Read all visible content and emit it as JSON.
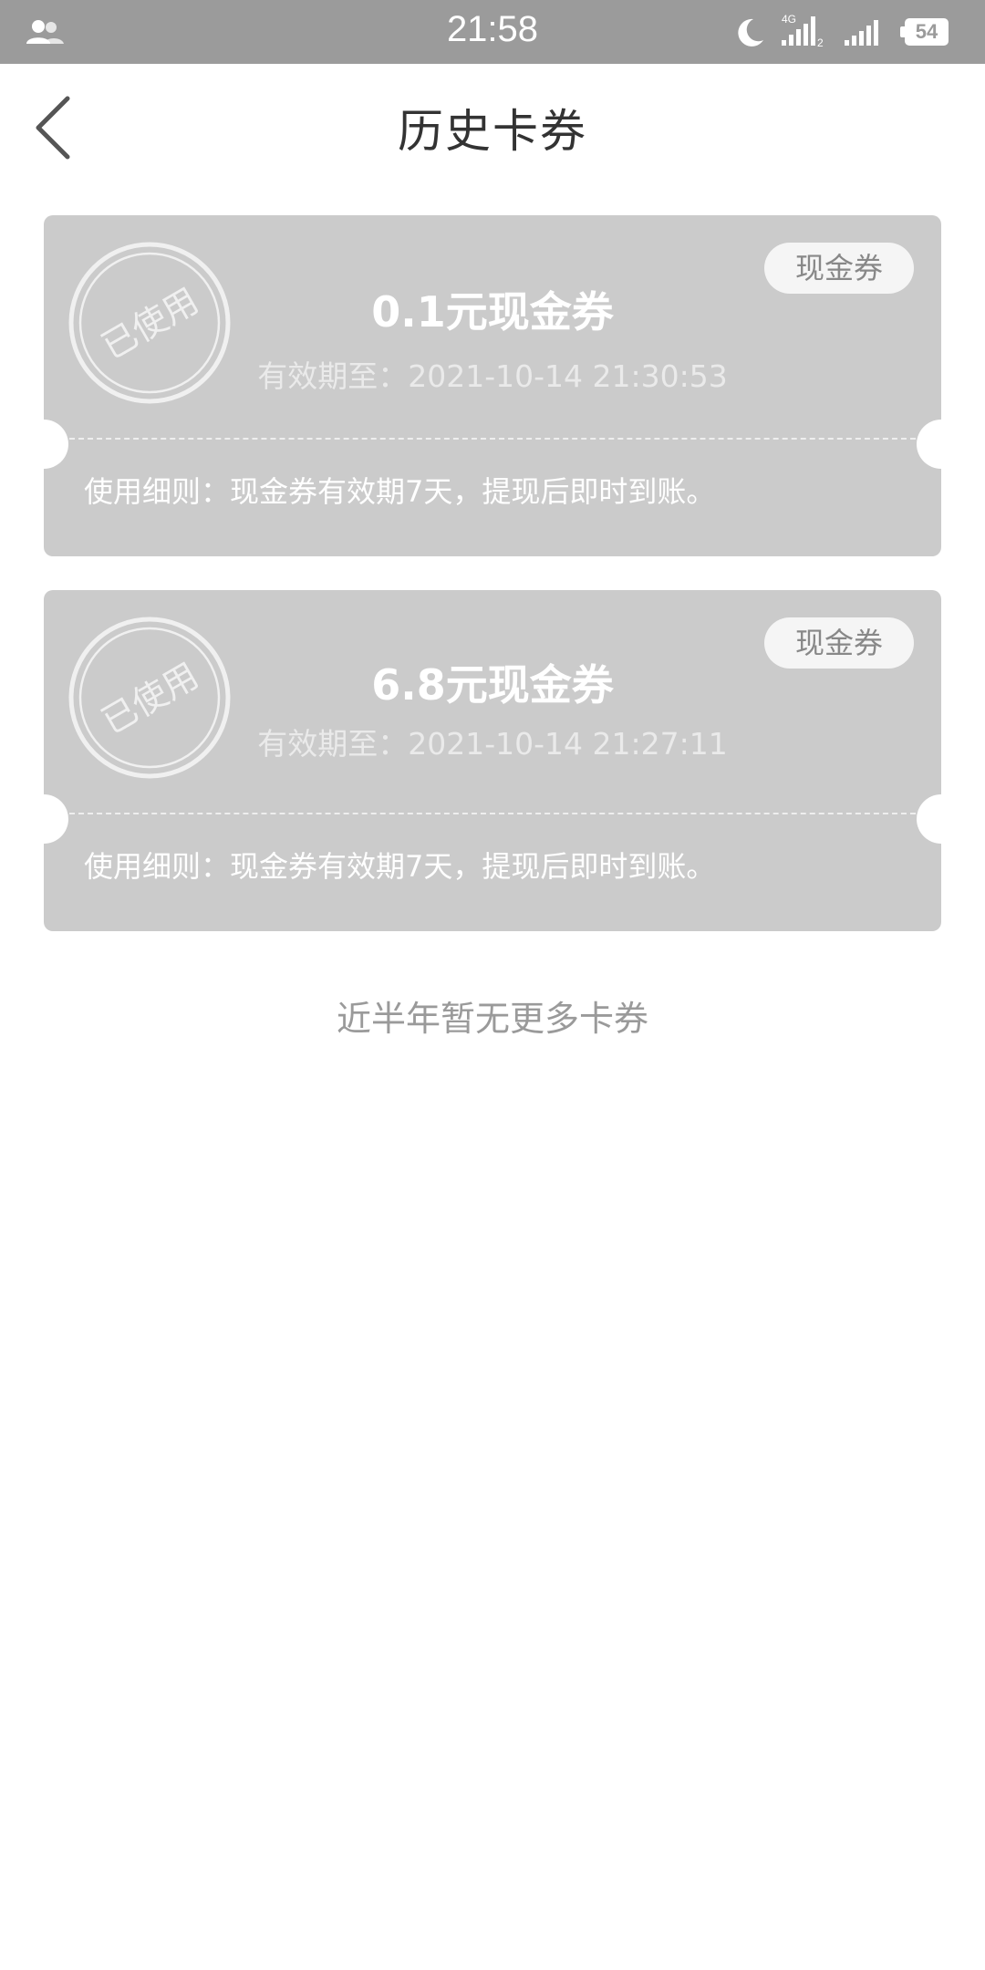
{
  "status_bar": {
    "time": "21:58",
    "battery": "54",
    "network_type": "4G",
    "sim_index": "2",
    "icons": [
      "contacts-icon",
      "moon-icon",
      "signal-icon",
      "signal-icon",
      "battery-icon"
    ]
  },
  "header": {
    "title": "历史卡券",
    "back_icon": "chevron-left-icon"
  },
  "coupons": [
    {
      "stamp": "已使用",
      "tag": "现金券",
      "amount": "0.1元现金券",
      "expiry": "有效期至：2021-10-14 21:30:53",
      "rules": "使用细则：现金券有效期7天，提现后即时到账。"
    },
    {
      "stamp": "已使用",
      "tag": "现金券",
      "amount": "6.8元现金券",
      "expiry": "有效期至：2021-10-14 21:27:11",
      "rules": "使用细则：现金券有效期7天，提现后即时到账。"
    }
  ],
  "footer": {
    "no_more_text": "近半年暂无更多卡券"
  },
  "colors": {
    "status_bar_bg": "#9b9b9b",
    "card_bg": "#cbcbcb",
    "page_bg": "#ffffff",
    "title_text": "#333333"
  }
}
